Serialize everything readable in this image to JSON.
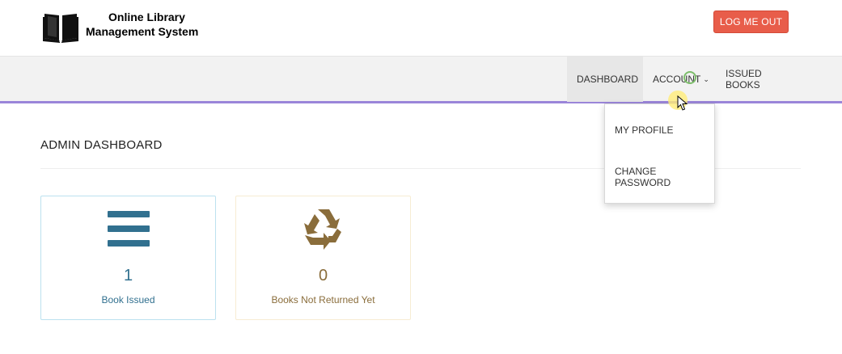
{
  "header": {
    "brand_line1": "Online Library",
    "brand_line2": "Management System",
    "logout_label": "LOG ME OUT",
    "logo_icon": "open-book-icon"
  },
  "nav": {
    "items": [
      {
        "label": "DASHBOARD"
      },
      {
        "label": "ACCOUNT",
        "icon": "chevron-down-icon"
      },
      {
        "label": "ISSUED BOOKS"
      }
    ],
    "accent_color": "#9a85d9"
  },
  "dropdown": {
    "items": [
      {
        "label": "MY PROFILE"
      },
      {
        "label": "CHANGE PASSWORD"
      }
    ]
  },
  "main": {
    "title": "ADMIN DASHBOARD",
    "cards": [
      {
        "icon": "bars-icon",
        "count": "1",
        "label": "Book Issued",
        "color": "#31708f"
      },
      {
        "icon": "recycle-icon",
        "count": "0",
        "label": "Books Not Returned Yet",
        "color": "#8a6d3b"
      }
    ]
  },
  "colors": {
    "logout_button": "#e85d4a",
    "navbar_bg": "#f2f2f2"
  }
}
